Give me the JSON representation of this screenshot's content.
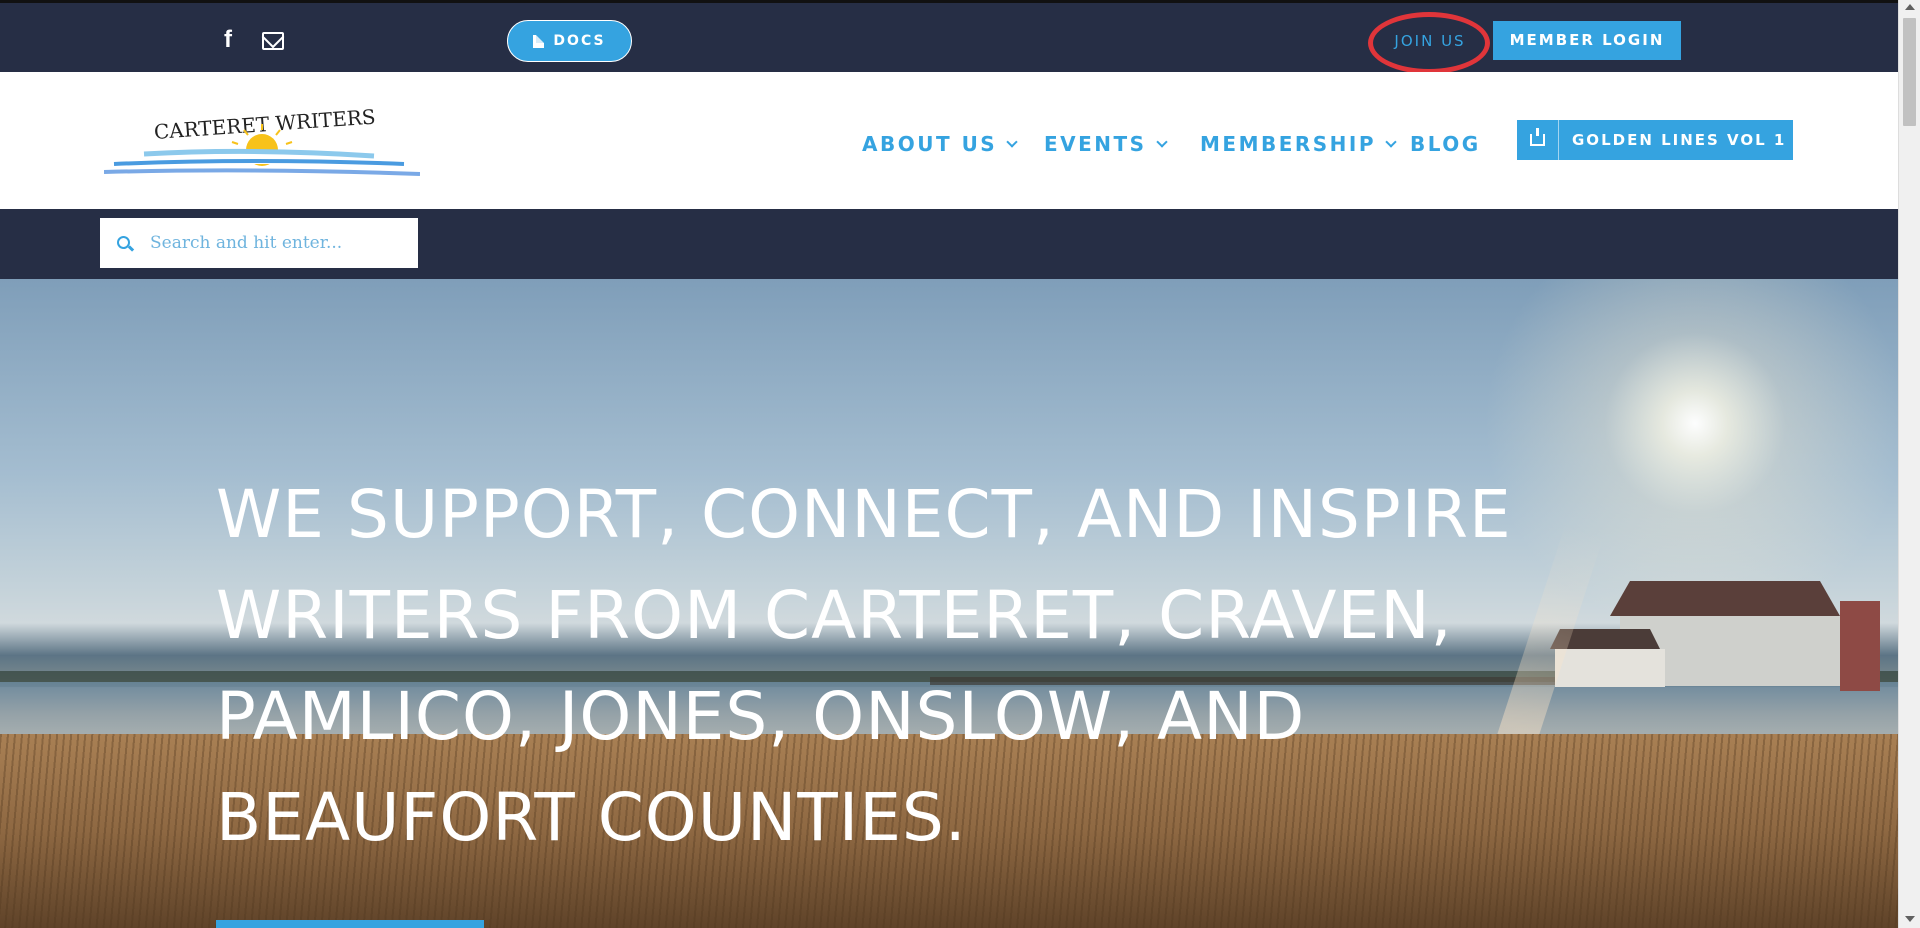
{
  "topbar": {
    "social_icons": [
      "facebook-icon",
      "mail-icon"
    ],
    "docs_label": "DOCS",
    "join_label": "JOIN US",
    "login_label": "MEMBER LOGIN"
  },
  "header": {
    "logo_text": "CARTERET WRITERS",
    "nav": [
      {
        "label": "ABOUT US",
        "has_dropdown": true
      },
      {
        "label": "EVENTS",
        "has_dropdown": true
      },
      {
        "label": "MEMBERSHIP",
        "has_dropdown": true
      },
      {
        "label": "BLOG",
        "has_dropdown": false
      }
    ],
    "golden_lines_label": "GOLDEN LINES VOL 1"
  },
  "search": {
    "placeholder": "Search and hit enter..."
  },
  "hero": {
    "headline_lines": [
      "WE SUPPORT, CONNECT, AND INSPIRE",
      "WRITERS FROM CARTERET, CRAVEN,",
      "PAMLICO, JONES, ONSLOW, AND",
      "BEAUFORT COUNTIES."
    ]
  },
  "colors": {
    "accent": "#35a3e0",
    "dark_bar": "#262e45",
    "highlight_circle": "#e0353a"
  }
}
